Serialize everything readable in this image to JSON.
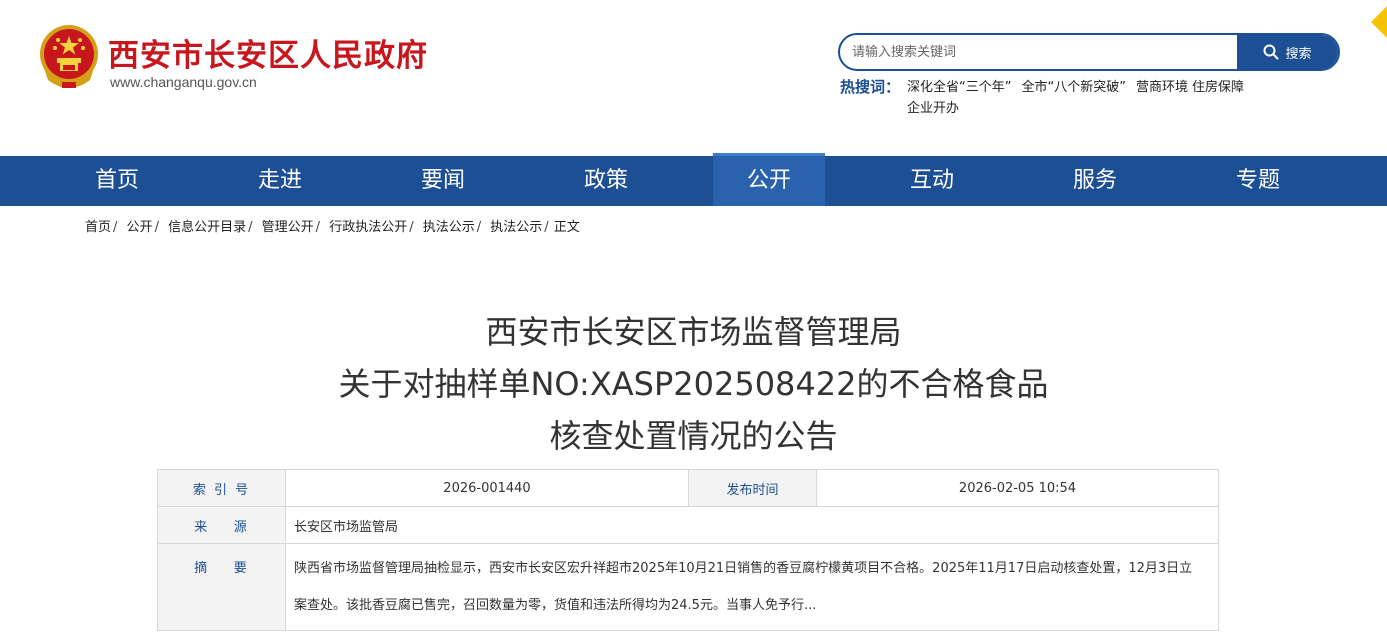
{
  "header": {
    "site_title": "西安市长安区人民政府",
    "site_domain": "www.changanqu.gov.cn",
    "emblem_icon": "national-emblem-icon",
    "brand_color": "#c8161d"
  },
  "search": {
    "placeholder": "请输入搜索关键词",
    "button_label": "搜索"
  },
  "hot_search": {
    "label": "热搜词：",
    "terms": [
      "深化全省“三个年”",
      "全市“八个新突破”",
      "营商环境",
      "住房保障",
      "企业开办"
    ]
  },
  "nav": {
    "color": "#1d4f94",
    "items": [
      {
        "label": "首页"
      },
      {
        "label": "走进"
      },
      {
        "label": "要闻"
      },
      {
        "label": "政策"
      },
      {
        "label": "公开",
        "active": true
      },
      {
        "label": "互动"
      },
      {
        "label": "服务"
      },
      {
        "label": "专题"
      }
    ]
  },
  "breadcrumb": [
    "首页",
    "公开",
    "信息公开目录",
    "管理公开",
    "行政执法公开",
    "执法公示",
    "执法公示",
    "正文"
  ],
  "article": {
    "title_lines": [
      "西安市长安区市场监督管理局",
      "关于对抽样单NO:XASP202508422的不合格食品",
      "核查处置情况的公告"
    ]
  },
  "info_table": {
    "index_label": "索 引 号",
    "index_value": "2026-001440",
    "publish_label": "发布时间",
    "publish_value": "2026-02-05 10:54",
    "source_label": "来    源",
    "source_value": "长安区市场监管局",
    "summary_label": "摘    要",
    "summary_value": "陕西省市场监督管理局抽检显示，西安市长安区宏升祥超市2025年10月21日销售的香豆腐柠檬黄项目不合格。2025年11月17日启动核查处置，12月3日立案查处。该批香豆腐已售完，召回数量为零，货值和违法所得均为24.5元。当事人免予行..."
  }
}
